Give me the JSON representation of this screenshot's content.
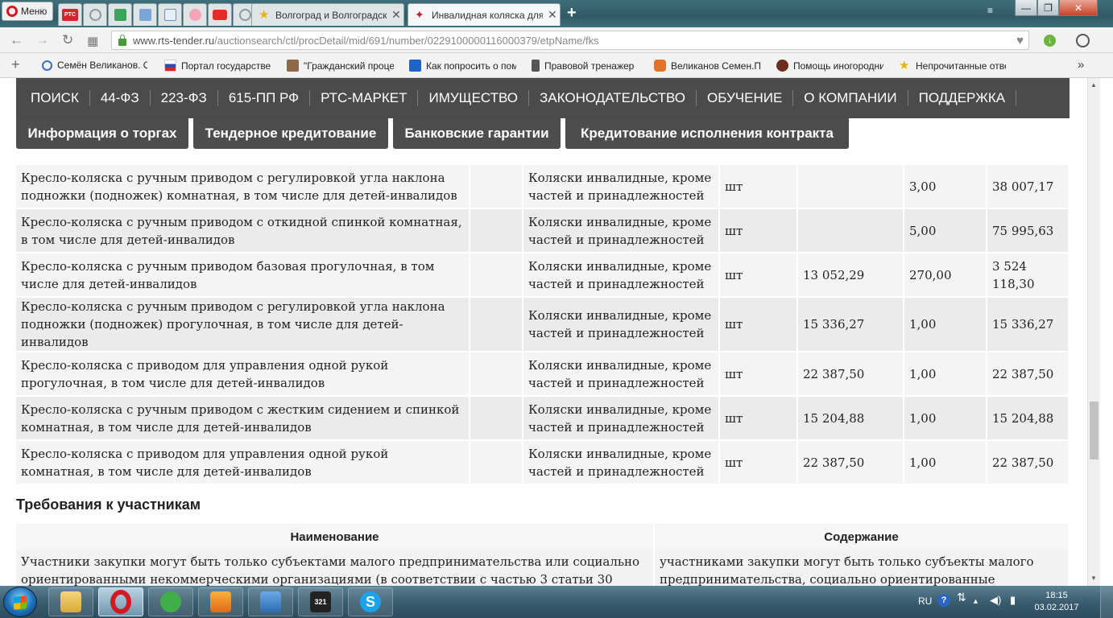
{
  "browser": {
    "menu_label": "Меню",
    "tabs": [
      {
        "title": "Волгоград и Волгоградск",
        "favicon": "star-icon"
      },
      {
        "title": "Инвалидная коляска для",
        "favicon": "bird-logo-icon"
      }
    ],
    "url": {
      "domain": "www.rts-tender.ru",
      "path": "/auctionsearch/ctl/procDetail/mid/691/number/0229100000116000379/etpName/fks"
    },
    "bookmarks": [
      {
        "label": "Семён Великанов. О",
        "icon": "globe-icon"
      },
      {
        "label": "Портал государствен",
        "icon": "russia-flag-icon"
      },
      {
        "label": "\"Гражданский проце",
        "icon": "book-icon"
      },
      {
        "label": "Как попросить о пом",
        "icon": "arrow-icon"
      },
      {
        "label": "Правовой тренажер",
        "icon": "figure-icon"
      },
      {
        "label": "Великанов Семен.По",
        "icon": "chat-icon"
      },
      {
        "label": "Помощь иногородни",
        "icon": "ladybug-icon"
      },
      {
        "label": "Непрочитанные отве",
        "icon": "star-icon"
      }
    ]
  },
  "site": {
    "nav": [
      "ПОИСК",
      "44-ФЗ",
      "223-ФЗ",
      "615-ПП РФ",
      "РТС-МАРКЕТ",
      "ИМУЩЕСТВО",
      "ЗАКОНОДАТЕЛЬСТВО",
      "ОБУЧЕНИЕ",
      "О КОМПАНИИ",
      "ПОДДЕРЖКА"
    ],
    "subnav": [
      "Информация о торгах",
      "Тендерное кредитование",
      "Банковские гарантии",
      "Кредитование исполнения контракта"
    ]
  },
  "lots": {
    "rows": [
      {
        "name": "Кресло-коляска с ручным приводом с регулировкой угла наклона подножки (подножек) комнатная, в том числе для детей-инвалидов",
        "code": "",
        "okpd": "Коляски инвалидные, кроме частей и принадлежностей",
        "unit": "шт",
        "price": "",
        "qty": "3,00",
        "total": "38 007,17"
      },
      {
        "name": "Кресло-коляска с ручным приводом с откидной спинкой комнатная, в том числе для детей-инвалидов",
        "code": "",
        "okpd": "Коляски инвалидные, кроме частей и принадлежностей",
        "unit": "шт",
        "price": "",
        "qty": "5,00",
        "total": "75 995,63"
      },
      {
        "name": "Кресло-коляска с ручным приводом базовая прогулочная, в том числе для детей-инвалидов",
        "code": "",
        "okpd": "Коляски инвалидные, кроме частей и принадлежностей",
        "unit": "шт",
        "price": "13 052,29",
        "qty": "270,00",
        "total": "3 524 118,30"
      },
      {
        "name": "Кресло-коляска с ручным приводом с регулировкой угла наклона подножки (подножек) прогулочная, в том числе для детей-инвалидов",
        "code": "",
        "okpd": "Коляски инвалидные, кроме частей и принадлежностей",
        "unit": "шт",
        "price": "15 336,27",
        "qty": "1,00",
        "total": "15 336,27"
      },
      {
        "name": "Кресло-коляска с приводом для управления одной рукой прогулочная, в том числе для детей-инвалидов",
        "code": "",
        "okpd": "Коляски инвалидные, кроме частей и принадлежностей",
        "unit": "шт",
        "price": "22 387,50",
        "qty": "1,00",
        "total": "22 387,50"
      },
      {
        "name": "Кресло-коляска с ручным приводом с жестким сидением и спинкой комнатная, в том числе для детей-инвалидов",
        "code": "",
        "okpd": "Коляски инвалидные, кроме частей и принадлежностей",
        "unit": "шт",
        "price": "15 204,88",
        "qty": "1,00",
        "total": "15 204,88"
      },
      {
        "name": "Кресло-коляска с приводом для управления одной рукой комнатная, в том числе для детей-инвалидов",
        "code": "",
        "okpd": "Коляски инвалидные, кроме частей и принадлежностей",
        "unit": "шт",
        "price": "22 387,50",
        "qty": "1,00",
        "total": "22 387,50"
      }
    ]
  },
  "requirements": {
    "title": "Требования к участникам",
    "headers": [
      "Наименование",
      "Содержание"
    ],
    "row": {
      "name": "Участники закупки могут быть только субъектами малого предпринимательства или социально ориентированными некоммерческими организациями (в соответствии с частью 3 статьи 30",
      "content": "участниками закупки могут быть только субъекты малого предпринимательства, социально ориентированные"
    }
  },
  "taskbar": {
    "apps": [
      {
        "name": "explorer",
        "icon": "folder-icon"
      },
      {
        "name": "opera",
        "icon": "opera-icon"
      },
      {
        "name": "chat",
        "icon": "chat-icon"
      },
      {
        "name": "video",
        "icon": "video-icon"
      },
      {
        "name": "downloader",
        "icon": "download-icon"
      },
      {
        "name": "media",
        "icon": "media-321-icon"
      },
      {
        "name": "skype",
        "icon": "skype-icon"
      }
    ],
    "lang": "RU",
    "time": "18:15",
    "date": "03.02.2017"
  },
  "colors": {
    "nav_bg": "#4b4b4b",
    "subnav_bg": "#4d4d4d",
    "row_odd": "#f4f4f4",
    "row_even": "#ebebeb"
  }
}
